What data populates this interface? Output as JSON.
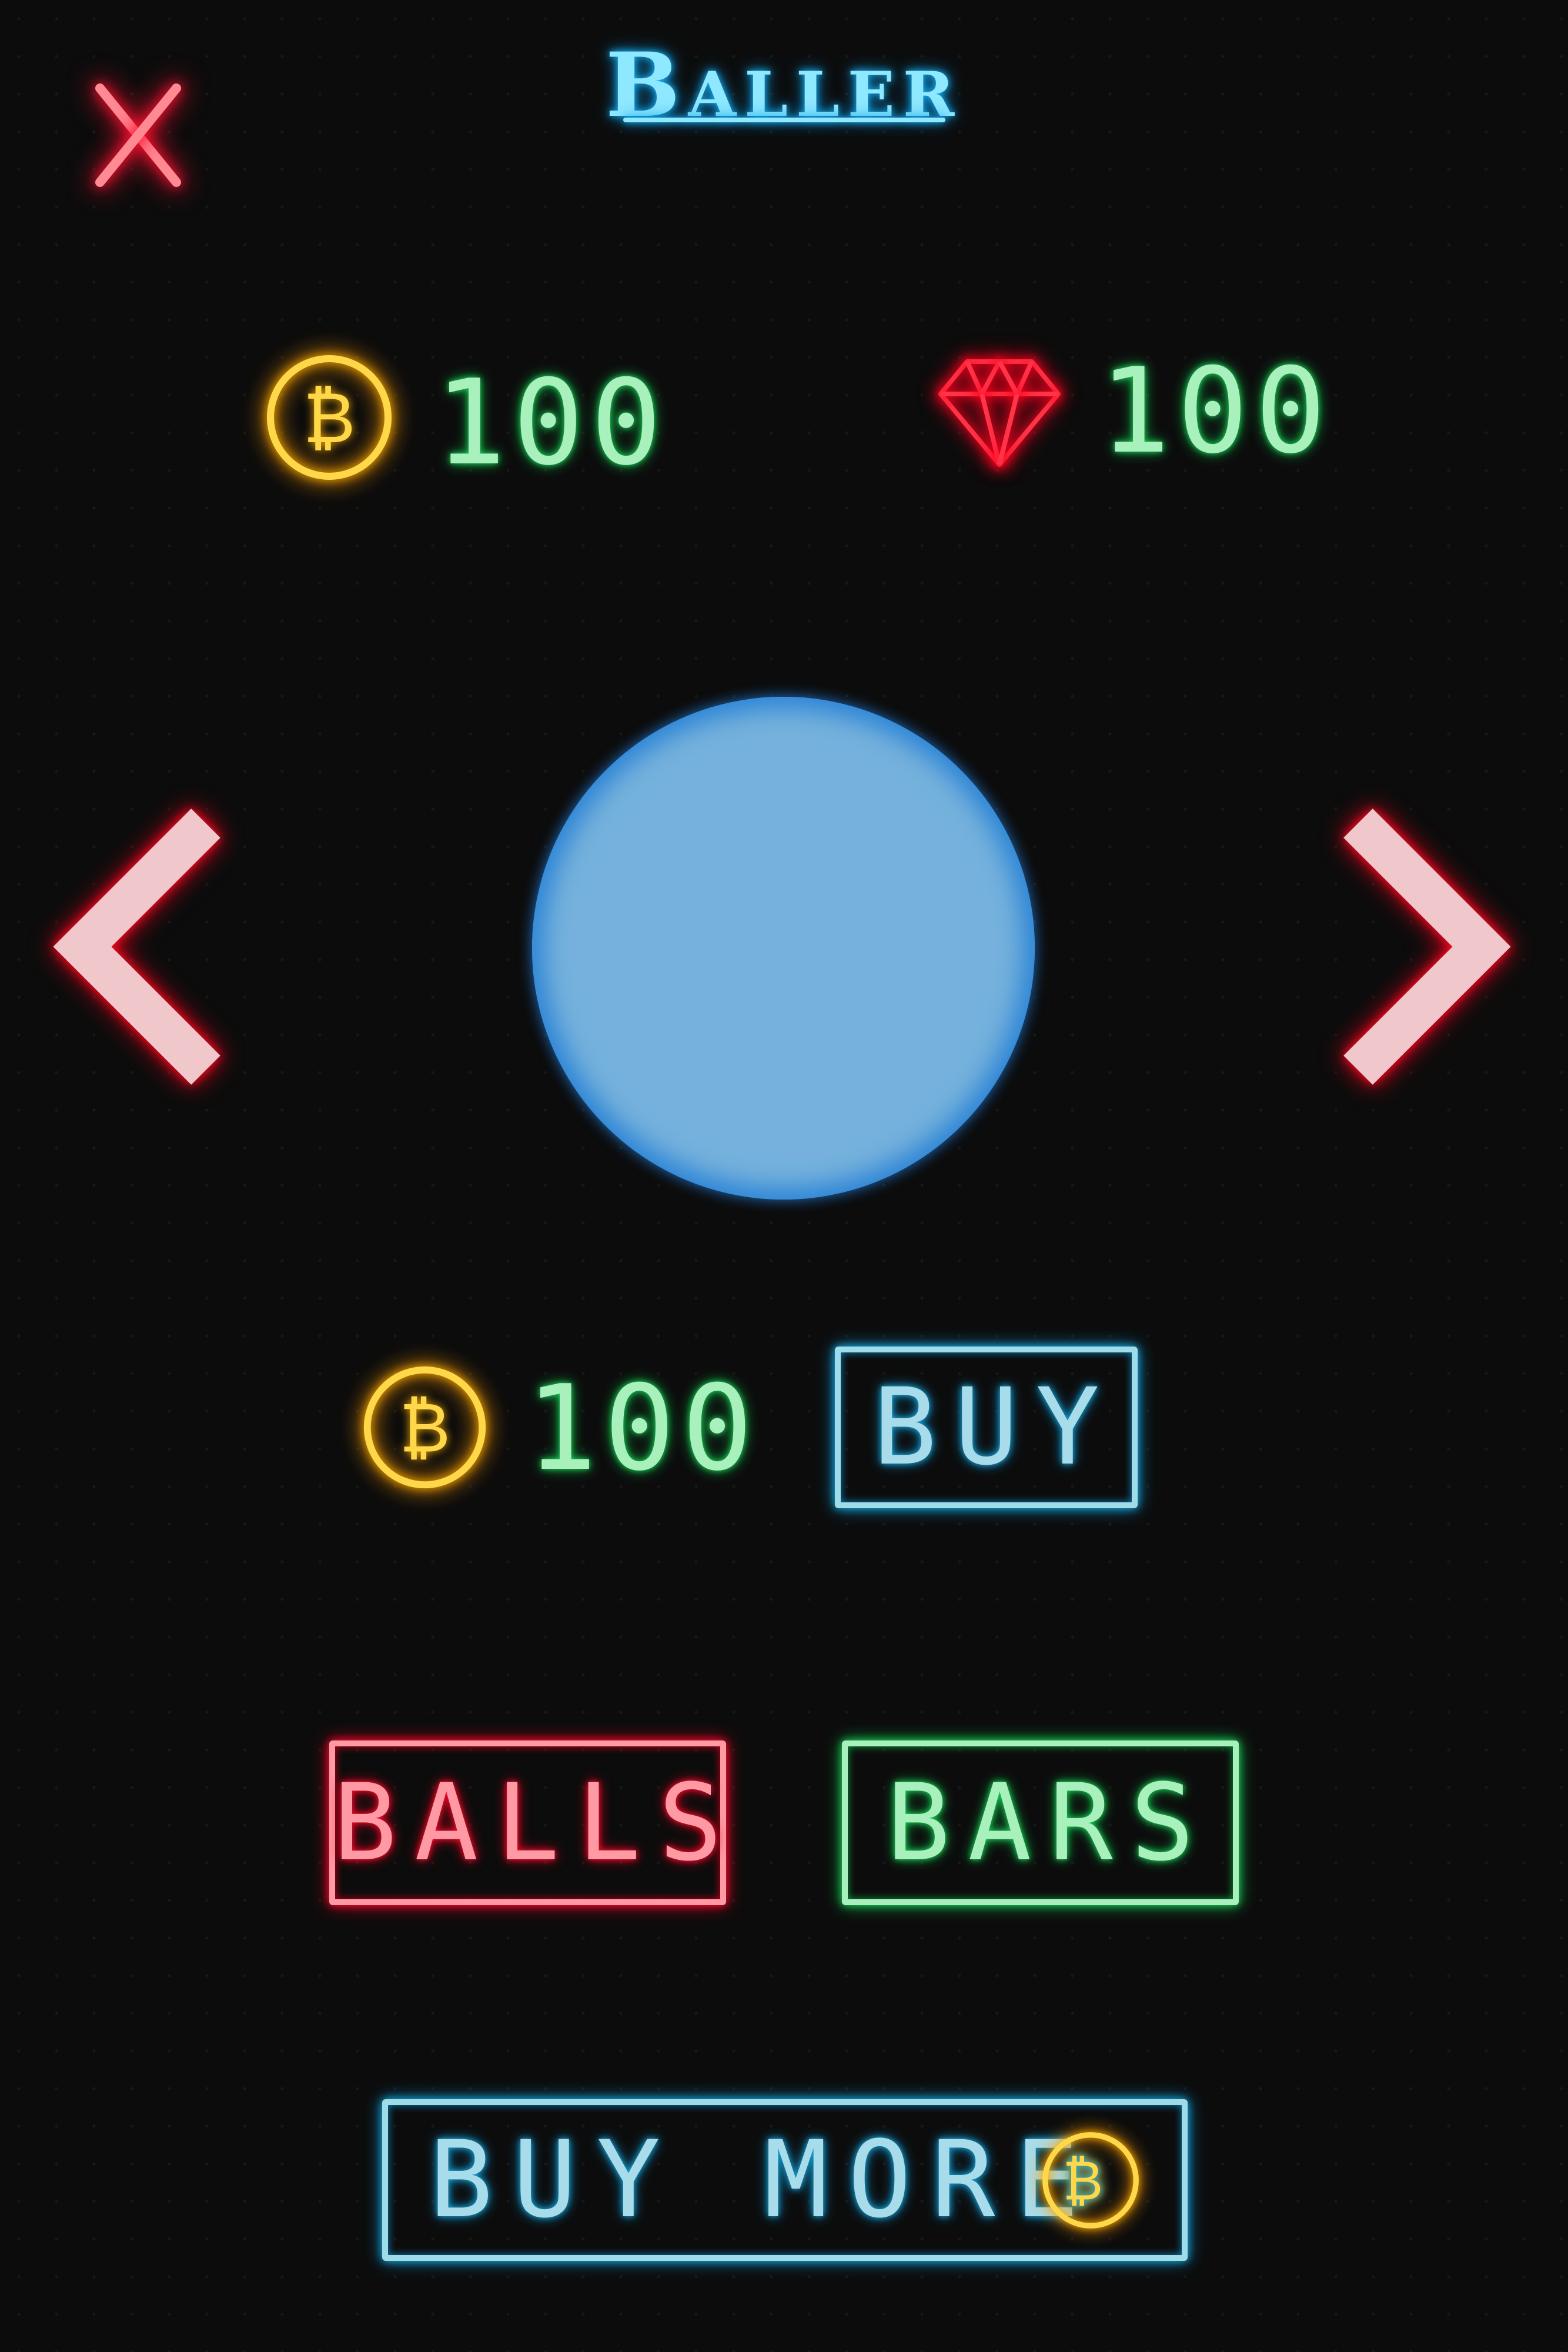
{
  "header": {
    "title": "Baller",
    "close_icon": "close-x-icon"
  },
  "balances": {
    "coins": "100",
    "coin_icon": "bitcoin-coin-icon",
    "coin_symbol": "₿",
    "gems": "100",
    "gem_icon": "diamond-gem-icon"
  },
  "preview": {
    "ball_color": "#75b1dc",
    "prev_icon": "chevron-left-icon",
    "next_icon": "chevron-right-icon"
  },
  "purchase": {
    "price": "100",
    "buy_label": "BUY"
  },
  "tabs": {
    "balls_label": "BALLS",
    "bars_label": "BARS"
  },
  "footer": {
    "buy_more_label": "BUY MORE"
  },
  "colors": {
    "background": "#0c0c0c",
    "neon_red": "#ff1030",
    "neon_green": "#1ed35a",
    "neon_blue": "#1aa8d8",
    "neon_yellow": "#ffd84a"
  }
}
